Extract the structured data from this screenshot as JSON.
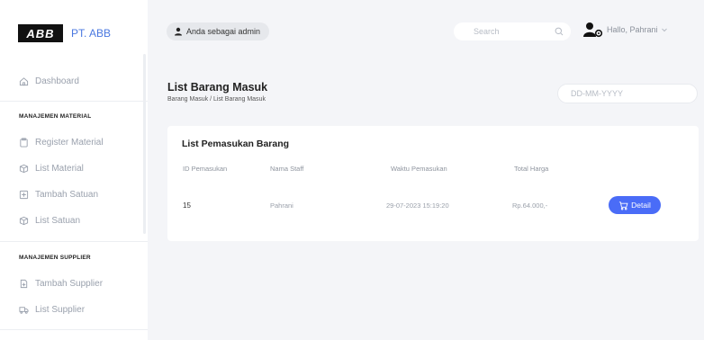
{
  "brand": {
    "logo_text": "ABB",
    "name": "PT. ABB"
  },
  "header": {
    "admin_badge": "Anda sebagai admin",
    "search_placeholder": "Search",
    "user_greeting": "Hallo, Pahrani"
  },
  "sidebar": {
    "dashboard": "Dashboard",
    "section_material": "MANAJEMEN MATERIAL",
    "register_material": "Register Material",
    "list_material": "List Material",
    "tambah_satuan": "Tambah Satuan",
    "list_satuan": "List Satuan",
    "section_supplier": "MANAJEMEN SUPPLIER",
    "tambah_supplier": "Tambah Supplier",
    "list_supplier": "List Supplier"
  },
  "main": {
    "title": "List Barang Masuk",
    "breadcrumb": "Barang Masuk / List Barang Masuk",
    "date_placeholder": "DD-MM-YYYY",
    "card_title": "List Pemasukan Barang",
    "columns": [
      "ID Pemasukan",
      "Nama Staff",
      "Waktu Pemasukan",
      "Total Harga"
    ],
    "rows": [
      {
        "id": "15",
        "staff": "Pahrani",
        "time": "29-07-2023 15:19:20",
        "total": "Rp.64.000,-",
        "action": "Detail"
      }
    ]
  }
}
